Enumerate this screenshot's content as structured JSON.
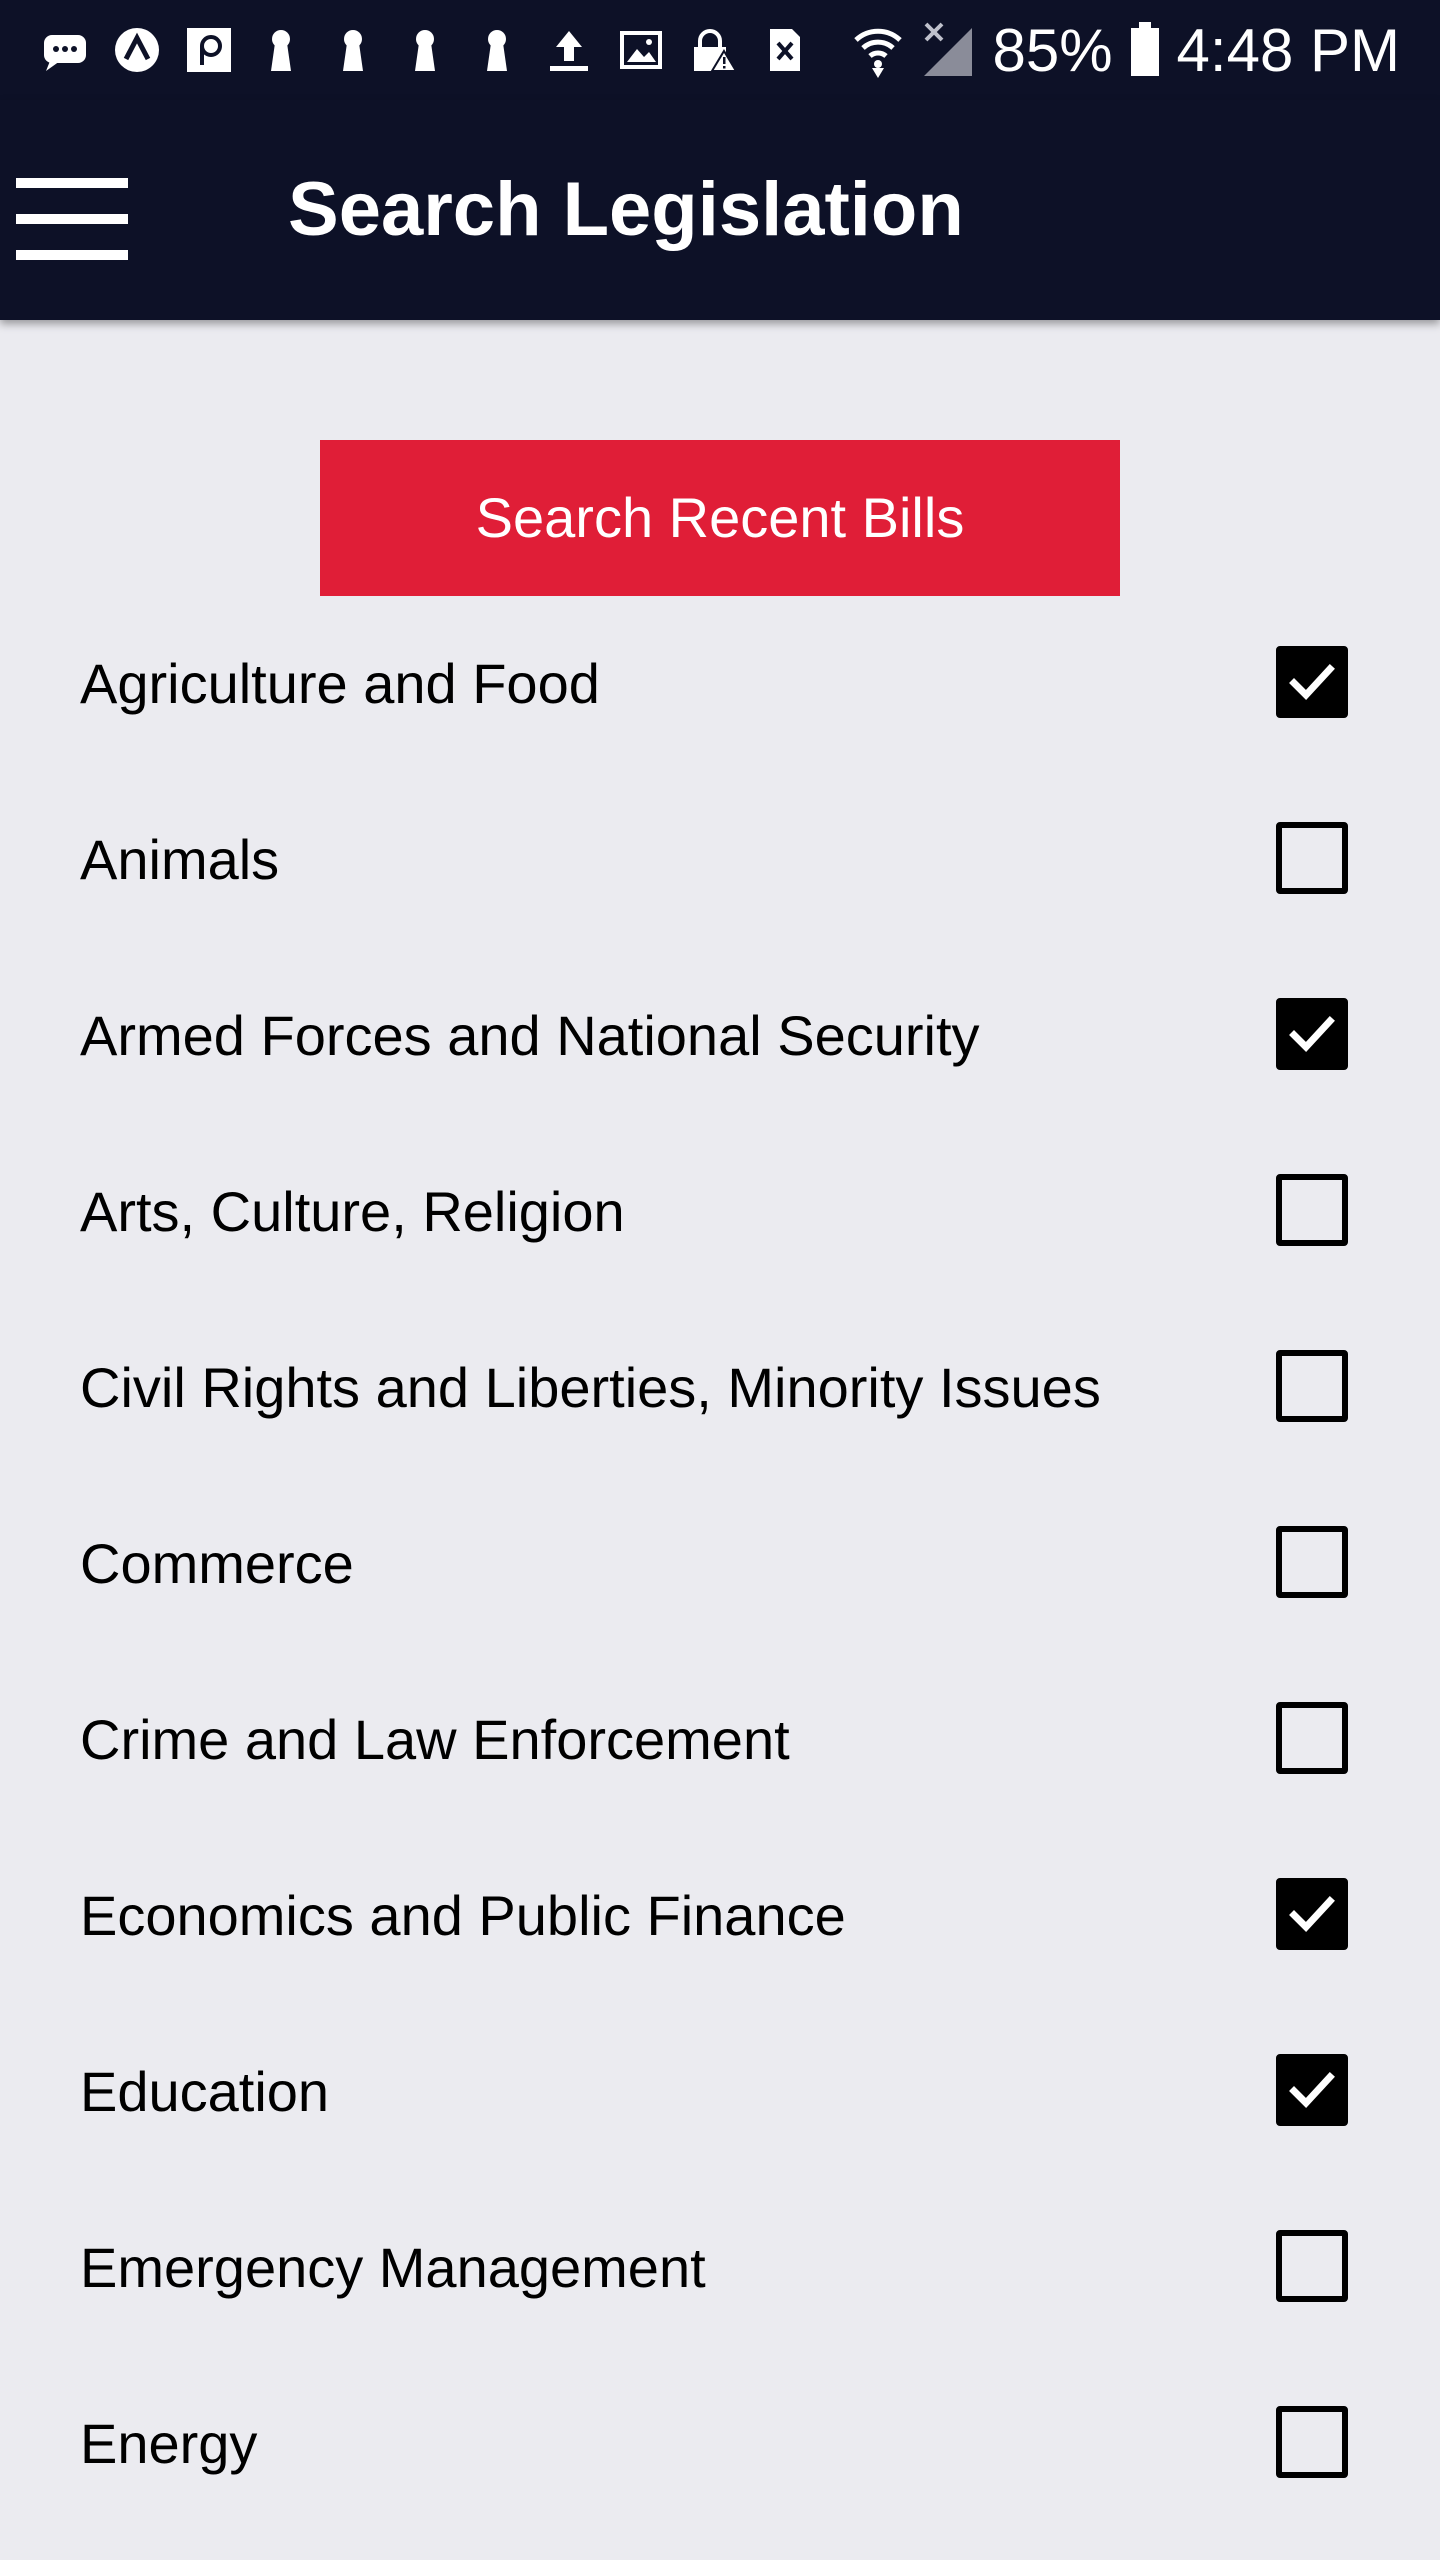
{
  "status_bar": {
    "icons": [
      "message-icon",
      "app-a-icon",
      "app-p-icon",
      "keyhole-icon",
      "keyhole-icon",
      "keyhole-icon",
      "keyhole-icon",
      "upload-icon",
      "image-icon",
      "vpn-lock-icon",
      "sim-error-icon"
    ],
    "battery_percent": "85%",
    "time": "4:48 PM"
  },
  "app_bar": {
    "title": "Search Legislation",
    "menu_icon": "hamburger-menu-icon"
  },
  "search_button": {
    "label": "Search Recent Bills",
    "color": "#e01e37"
  },
  "categories": [
    {
      "label": "Agriculture and Food",
      "checked": true
    },
    {
      "label": "Animals",
      "checked": false
    },
    {
      "label": "Armed Forces and National Security",
      "checked": true
    },
    {
      "label": "Arts, Culture, Religion",
      "checked": false
    },
    {
      "label": "Civil Rights and Liberties, Minority Issues",
      "checked": false
    },
    {
      "label": "Commerce",
      "checked": false
    },
    {
      "label": "Crime and Law Enforcement",
      "checked": false
    },
    {
      "label": "Economics and Public Finance",
      "checked": true
    },
    {
      "label": "Education",
      "checked": true
    },
    {
      "label": "Emergency Management",
      "checked": false
    },
    {
      "label": "Energy",
      "checked": false
    }
  ],
  "colors": {
    "header_bg": "#0d1127",
    "page_bg": "#ebebf0",
    "accent": "#e01e37"
  }
}
